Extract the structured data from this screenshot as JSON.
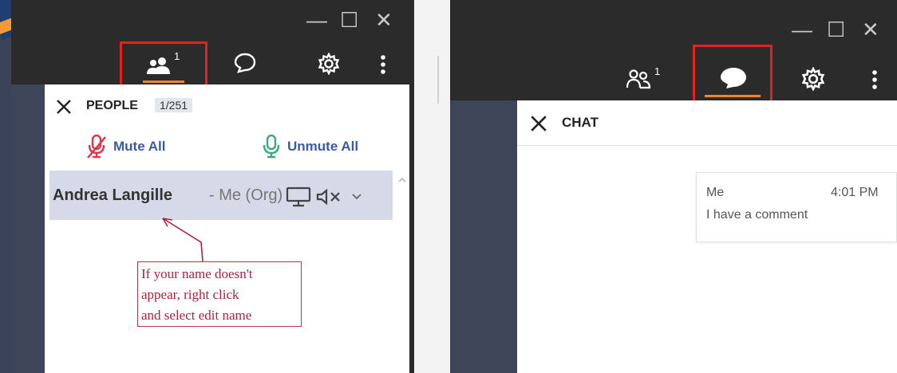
{
  "people_window": {
    "window_controls": {
      "minimize": "—",
      "maximize": "☐",
      "close": "✕"
    },
    "toolbar": {
      "participants_count": "1"
    },
    "panel": {
      "title": "PEOPLE",
      "count": "1/251",
      "mute_all_label": "Mute All",
      "unmute_all_label": "Unmute All",
      "participant": {
        "name": "Andrea Langille",
        "role": "- Me (Org)"
      }
    },
    "annotation": {
      "line1": "If your name doesn't",
      "line2": "appear,  right click",
      "line3": "and select edit name"
    }
  },
  "chat_window": {
    "window_controls": {
      "minimize": "—",
      "maximize": "☐",
      "close": "✕"
    },
    "toolbar": {
      "participants_count": "1"
    },
    "panel": {
      "title": "CHAT"
    },
    "message": {
      "sender": "Me",
      "time": "4:01 PM",
      "text": "I have a comment"
    }
  },
  "colors": {
    "highlight": "#e2231a",
    "active_tab_underline": "#e8883a",
    "mute_icon": "#e0344b",
    "unmute_icon": "#3aaa7a",
    "annotation": "#b0213d"
  },
  "icons": [
    "people-icon",
    "chat-icon",
    "gear-icon",
    "more-vertical-icon",
    "close-icon",
    "mic-muted-icon",
    "mic-icon",
    "screen-share-icon",
    "speaker-muted-icon",
    "chevron-down-icon"
  ]
}
